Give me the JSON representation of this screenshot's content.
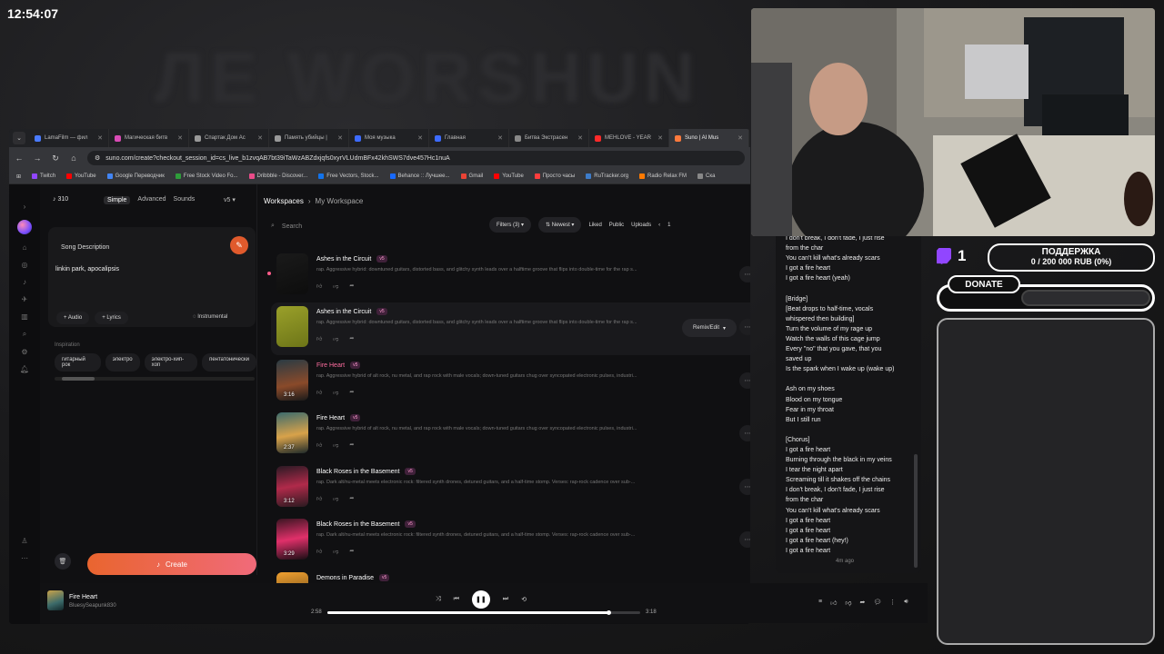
{
  "clock": "12:54:07",
  "backdrop_word": "ЛЕ WORSHUN",
  "browser": {
    "tabs": [
      {
        "label": "LamaFilm — фил",
        "color": "#4a7bff"
      },
      {
        "label": "Магическая битв",
        "color": "#d84bb5"
      },
      {
        "label": "Спартак Дом Ас",
        "color": "#999999"
      },
      {
        "label": "Память убийцы |",
        "color": "#999999"
      },
      {
        "label": "Моя музыка",
        "color": "#3d6bff"
      },
      {
        "label": "Главная",
        "color": "#3d6bff"
      },
      {
        "label": "Битва Экстрасен",
        "color": "#888888"
      },
      {
        "label": "MEHLOVE - YEAR",
        "color": "#ff2a2a"
      },
      {
        "label": "Suno | AI Mus",
        "color": "#ff7a3d"
      }
    ],
    "url": "suno.com/create?checkout_session_id=cs_live_b1zvqAB7bt39iTaWzABZdxjqfs0xyrVLUdmBFx42khSWS7dve457Hc1nuA",
    "bookmarks": [
      {
        "label": "Twitch",
        "color": "#9146ff"
      },
      {
        "label": "YouTube",
        "color": "#ff0000"
      },
      {
        "label": "Google Переводчик",
        "color": "#4285f4"
      },
      {
        "label": "Free Stock Video Fo...",
        "color": "#2e9d3a"
      },
      {
        "label": "Dribbble - Discover...",
        "color": "#ea4c89"
      },
      {
        "label": "Free Vectors, Stock...",
        "color": "#1273eb"
      },
      {
        "label": "Behance :: Лучшее...",
        "color": "#1769ff"
      },
      {
        "label": "Gmail",
        "color": "#ea4335"
      },
      {
        "label": "YouTube",
        "color": "#ff0000"
      },
      {
        "label": "Просто часы",
        "color": "#ff3d3d"
      },
      {
        "label": "RuTracker.org",
        "color": "#3d7cc9"
      },
      {
        "label": "Radio Relax FM",
        "color": "#ff7a00"
      },
      {
        "label": "Ска",
        "color": "#888888"
      }
    ]
  },
  "suno": {
    "credits": "310",
    "modes": [
      "Simple",
      "Advanced",
      "Sounds"
    ],
    "version": "v5",
    "song_description_label": "Song Description",
    "song_description_value": "linkin park, apocalipsis",
    "audio_label": "Audio",
    "lyrics_label": "Lyrics",
    "instrumental_label": "Instrumental",
    "inspiration_label": "Inspiration",
    "inspiration_tags": [
      "гитарный рок",
      "электро",
      "электро-хип-хоп",
      "пентатонически"
    ],
    "create_label": "Create",
    "breadcrumb": {
      "root": "Workspaces",
      "current": "My Workspace"
    },
    "search_placeholder": "Search",
    "filters_label": "Filters (3)",
    "sort_label": "Newest",
    "toolbar_items": [
      "Liked",
      "Public",
      "Uploads"
    ],
    "page": "1",
    "remix_label": "Remix/Edit",
    "songs": [
      {
        "title": "Ashes in the Circuit",
        "badge": "v5",
        "desc": "rap. Aggressive hybrid: downtuned guitars, distorted bass, and glitchy synth leads over a halftime groove that flips into double-time for the rap s...",
        "duration": ""
      },
      {
        "title": "Ashes in the Circuit",
        "badge": "v5",
        "desc": "rap. Aggressive hybrid: downtuned guitars, distorted bass, and glitchy synth leads over a halftime groove that flips into double-time for the rap s...",
        "duration": ""
      },
      {
        "title": "Fire Heart",
        "badge": "v5",
        "desc": "rap. Aggressive hybrid of alt rock, nu metal, and rap rock with male vocals; down-tuned guitars chug over syncopated electronic pulses, industri...",
        "duration": "3:16"
      },
      {
        "title": "Fire Heart",
        "badge": "v5",
        "desc": "rap. Aggressive hybrid of alt rock, nu metal, and rap rock with male vocals; down-tuned guitars chug over syncopated electronic pulses, industri...",
        "duration": "2:37"
      },
      {
        "title": "Black Roses in the Basement",
        "badge": "v5",
        "desc": "rap. Dark alt/nu-metal meets electronic rock: filtered synth drones, detuned guitars, and a half-time stomp. Verses: rap-rock cadence over sub-...",
        "duration": "3:12"
      },
      {
        "title": "Black Roses in the Basement",
        "badge": "v5",
        "desc": "rap. Dark alt/nu-metal meets electronic rock: filtered synth drones, detuned guitars, and a half-time stomp. Verses: rap-rock cadence over sub-...",
        "duration": "3:29"
      },
      {
        "title": "Demons in Paradise",
        "badge": "v5",
        "desc": "",
        "duration": ""
      }
    ],
    "lyrics": "I don't break, I don't fade, I just rise\nfrom the char\nYou can't kill what's already scars\nI got a fire heart\nI got a fire heart (yeah)\n\n[Bridge]\n[Beat drops to half-time, vocals\nwhispered then building]\nTurn the volume of my rage up\nWatch the walls of this cage jump\nEvery \"no\" that you gave, that you\nsaved up\nIs the spark when I wake up (wake up)\n\nAsh on my shoes\nBlood on my tongue\nFear in my throat\nBut I still run\n\n[Chorus]\nI got a fire heart\nBurning through the black in my veins\nI tear the night apart\nScreaming till it shakes off the chains\nI don't break, I don't fade, I just rise\nfrom the char\nYou can't kill what's already scars\nI got a fire heart\nI got a fire heart\nI got a fire heart (hey!)\nI got a fire heart",
    "lyrics_time": "4m ago",
    "player": {
      "title": "Fire Heart",
      "artist": "BluesySeapunk830",
      "elapsed": "2:58",
      "total": "3:18",
      "progress": 0.9
    }
  },
  "stream": {
    "viewers": "1",
    "goal_title": "ПОДДЕРЖКА",
    "goal_value": "0 / 200 000 RUB (0%)",
    "donate_label": "DONATE"
  }
}
